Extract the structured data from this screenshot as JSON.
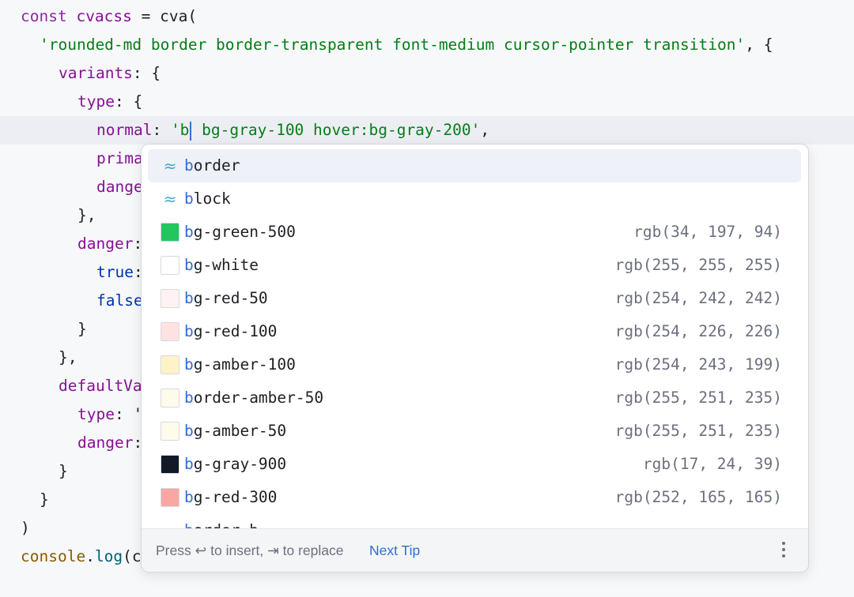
{
  "editor": {
    "lines": {
      "l1": {
        "kw": "const ",
        "var": "cvacss",
        "rest": " = ",
        "fn": "cva",
        "end": "("
      },
      "l2": {
        "str": "'rounded-md border border-transparent font-medium cursor-pointer transition'",
        "end": ", {"
      },
      "l3": {
        "prop": "variants",
        "end": ": {"
      },
      "l4": {
        "prop": "type",
        "end": ": {"
      },
      "l5": {
        "prop": "normal",
        "sep": ": ",
        "str_a": "'b",
        "str_b": " bg-gray-100 hover:bg-gray-200'",
        "end": ","
      },
      "l6": {
        "prop": "prima"
      },
      "l7": {
        "prop": "dange"
      },
      "l8": {
        "text": "},"
      },
      "l9": {
        "prop": "danger",
        "end": ":"
      },
      "l10": {
        "prop": "true",
        "end": ":"
      },
      "l11": {
        "prop": "false"
      },
      "l12": {
        "text": "}"
      },
      "l13": {
        "text": "},"
      },
      "l14": {
        "prop": "defaultVa"
      },
      "l15": {
        "prop": "type",
        "end": ": '"
      },
      "l16": {
        "prop": "danger",
        "end": ":"
      },
      "l17": {
        "text": "}"
      },
      "l18": {
        "text": "}"
      },
      "l19": {
        "text": ")"
      },
      "l20": {
        "obj": "console",
        "dot": ".",
        "fn": "log",
        "end": "(c"
      }
    }
  },
  "completion": {
    "items": [
      {
        "match": "b",
        "rest": "order",
        "icon": "tailwind-icon",
        "value": ""
      },
      {
        "match": "b",
        "rest": "lock",
        "icon": "tailwind-icon",
        "value": ""
      },
      {
        "match": "b",
        "rest": "g-green-500",
        "color": "#22c55e",
        "value": "rgb(34, 197, 94)"
      },
      {
        "match": "b",
        "rest": "g-white",
        "color": "#ffffff",
        "value": "rgb(255, 255, 255)"
      },
      {
        "match": "b",
        "rest": "g-red-50",
        "color": "#fef2f2",
        "value": "rgb(254, 242, 242)"
      },
      {
        "match": "b",
        "rest": "g-red-100",
        "color": "#fee2e2",
        "value": "rgb(254, 226, 226)"
      },
      {
        "match": "b",
        "rest": "g-amber-100",
        "color": "#fef3c7",
        "value": "rgb(254, 243, 199)"
      },
      {
        "match": "b",
        "rest": "order-amber-50",
        "color": "#fffbeb",
        "value": "rgb(255, 251, 235)"
      },
      {
        "match": "b",
        "rest": "g-amber-50",
        "color": "#fffbeb",
        "value": "rgb(255, 251, 235)"
      },
      {
        "match": "b",
        "rest": "g-gray-900",
        "color": "#111827",
        "value": "rgb(17, 24, 39)"
      },
      {
        "match": "b",
        "rest": "g-red-300",
        "color": "#fca5a5",
        "value": "rgb(252, 165, 165)"
      },
      {
        "match": "b",
        "rest": "order-b",
        "icon": "tailwind-icon",
        "value": ""
      }
    ],
    "footer": {
      "hint": "Press ↩ to insert, ⇥ to replace",
      "next_tip": "Next Tip"
    }
  }
}
